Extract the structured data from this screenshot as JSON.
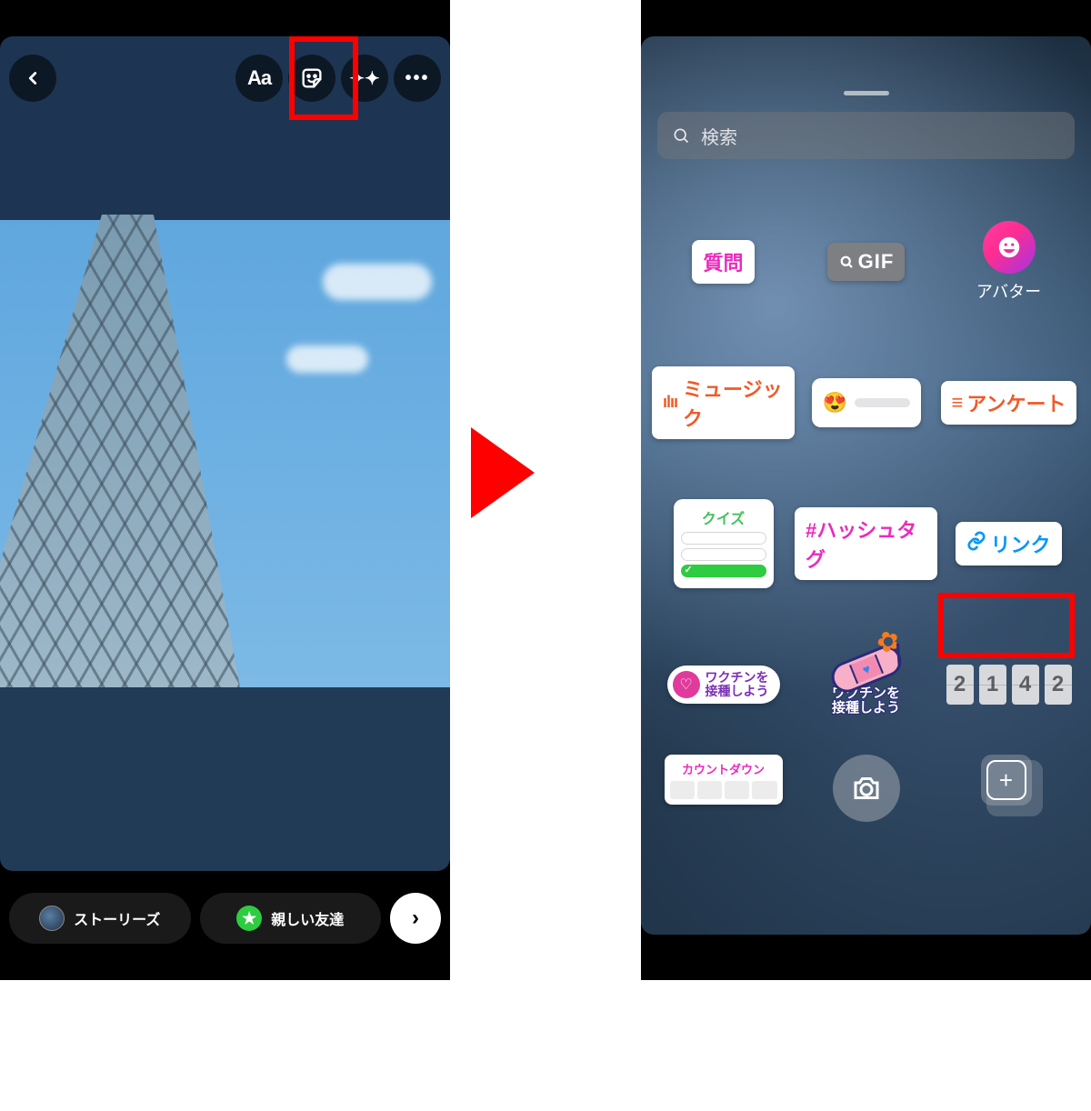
{
  "left": {
    "toolbar": {
      "text_tool_label": "Aa",
      "sparkle_glyph": "✦✦",
      "more_glyph": "•••"
    },
    "share": {
      "stories_label": "ストーリーズ",
      "close_friends_label": "親しい友達",
      "star_glyph": "★",
      "send_glyph": "›"
    }
  },
  "right": {
    "search_placeholder": "検索",
    "stickers": {
      "question": "質問",
      "gif": "GIF",
      "avatar": "アバター",
      "music": "ミュージック",
      "poll": "アンケート",
      "quiz": "クイズ",
      "hashtag": "#ハッシュタグ",
      "link": "リンク",
      "vaccine_line1": "ワクチンを",
      "vaccine_line2": "接種しよう",
      "bandaid_line1": "ワクチンを",
      "bandaid_line2": "接種しよう",
      "time_digits": [
        "2",
        "1",
        "4",
        "2"
      ],
      "countdown": "カウントダウン",
      "emoji_slider_emoji": "😍",
      "poll_glyph": "≡",
      "music_bars": "ılıı",
      "heart_glyph": "♡",
      "link_glyph": "🔗"
    }
  }
}
